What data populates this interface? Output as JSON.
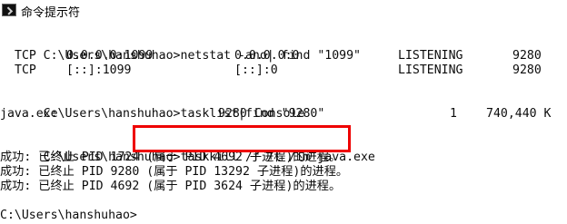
{
  "window": {
    "title": "命令提示符"
  },
  "console": {
    "cmd1": {
      "prompt": "C:\\Users\\hanshuhao>",
      "command": "netstat -ano| find \"1099\""
    },
    "netstat_rows": [
      {
        "proto": "TCP",
        "local": "0.0.0.0:1099",
        "foreign": "0.0.0.0:0",
        "state": "LISTENING",
        "pid": "9280"
      },
      {
        "proto": "TCP",
        "local": "[::]:1099",
        "foreign": "[::]:0",
        "state": "LISTENING",
        "pid": "9280"
      }
    ],
    "cmd2": {
      "prompt": "C:\\Users\\hanshuhao>",
      "command": "tasklist|find \"9280\""
    },
    "tasklist_row": {
      "image": "java.exe",
      "pid_session": "9280 Console",
      "session_num": "1",
      "mem": "740,440 K"
    },
    "cmd3": {
      "prompt": "C:\\Users\\hanshuhao>",
      "command": "taskkill /f /t /im java.exe"
    },
    "kill_results": [
      "成功: 已终止 PID 1724 (属于 PID 4692 子进程)的进程。",
      "成功: 已终止 PID 9280 (属于 PID 13292 子进程)的进程。",
      "成功: 已终止 PID 4692 (属于 PID 3624 子进程)的进程。"
    ],
    "final_prompt": "C:\\Users\\hanshuhao>"
  },
  "highlight": {
    "color": "#ee0000"
  }
}
